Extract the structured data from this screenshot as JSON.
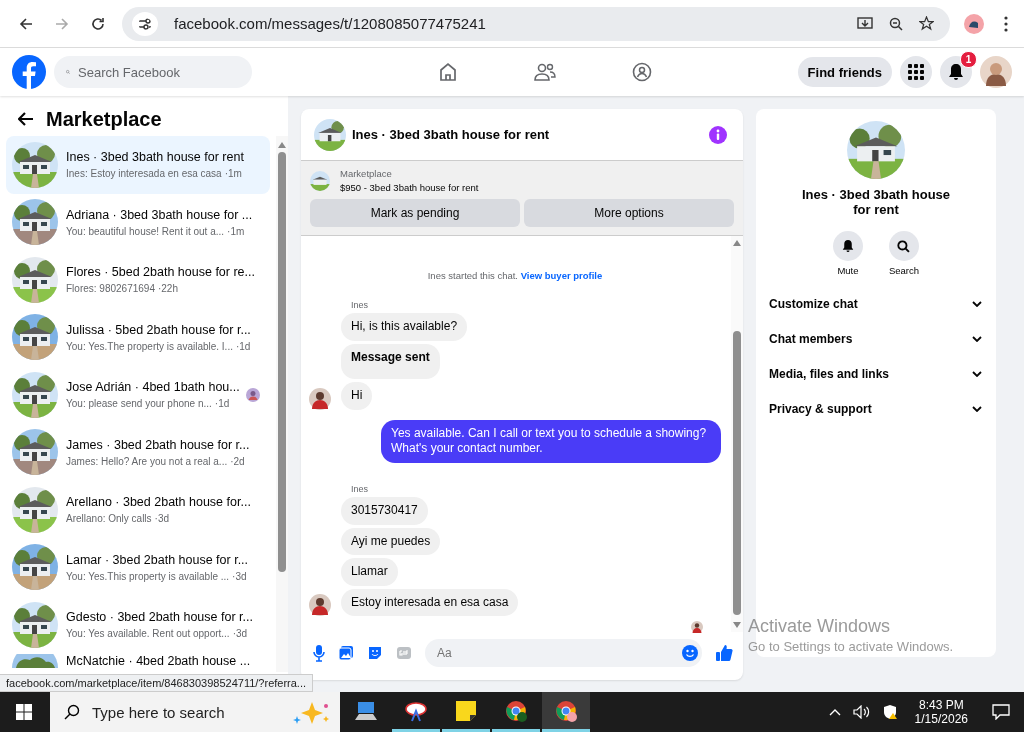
{
  "browser": {
    "url": "facebook.com/messages/t/1208085077475241"
  },
  "header": {
    "search": {
      "placeholder": "Search Facebook"
    },
    "find_friends": "Find friends",
    "notification_count": "1"
  },
  "sidebar": {
    "title": "Marketplace",
    "conversations": [
      {
        "title": "Ines · 3bed 3bath house for rent",
        "preview": "Ines: Estoy interesada en esa casa",
        "time": "·1m",
        "selected": true,
        "seen": false
      },
      {
        "title": "Adriana · 3bed 3bath house for ...",
        "preview": "You: beautiful house! Rent it out a...",
        "time": "·1m",
        "selected": false,
        "seen": false
      },
      {
        "title": "Flores · 5bed 2bath house for re...",
        "preview": "Flores: 9802671694",
        "time": "·22h",
        "selected": false,
        "seen": false
      },
      {
        "title": "Julissa · 5bed 2bath house for r...",
        "preview": "You: Yes.The property is available. I...",
        "time": "·1d",
        "selected": false,
        "seen": false
      },
      {
        "title": "Jose Adrián · 4bed 1bath hou...",
        "preview": "You: please send your phone n...",
        "time": "·1d",
        "selected": false,
        "seen": true
      },
      {
        "title": "James · 3bed 2bath house for r...",
        "preview": "James: Hello? Are you not a real a...",
        "time": "·2d",
        "selected": false,
        "seen": false
      },
      {
        "title": "Arellano · 3bed 2bath house for...",
        "preview": "Arellano: Only calls",
        "time": "·3d",
        "selected": false,
        "seen": false
      },
      {
        "title": "Lamar · 3bed 2bath house for r...",
        "preview": "You: Yes.This property is available ...",
        "time": "·3d",
        "selected": false,
        "seen": false
      },
      {
        "title": "Gdesto · 3bed 2bath house for r...",
        "preview": "You: Yes available. Rent out opport...",
        "time": "·3d",
        "selected": false,
        "seen": false
      },
      {
        "title": "McNatchie · 4bed 2bath house ...",
        "selected": false,
        "seen": false
      }
    ]
  },
  "chat": {
    "title": "Ines · 3bed 3bath house for rent",
    "listing": {
      "label": "Marketplace",
      "price_title": "$950 - 3bed 3bath house for rent",
      "buttons": [
        "Mark as pending",
        "More options"
      ]
    },
    "messages": [
      {
        "kind": "system",
        "text": "Ines started this chat.",
        "link": "View buyer profile"
      },
      {
        "kind": "sender",
        "text": "Ines"
      },
      {
        "kind": "incoming",
        "text": "Hi, is this available?",
        "avatar": false
      },
      {
        "kind": "notice",
        "text": "Message sent",
        "avatar": false
      },
      {
        "kind": "incoming",
        "text": "Hi",
        "avatar": true
      },
      {
        "kind": "outgoing",
        "text": "Yes available. Can I call or text you to schedule a showing? What's your contact number."
      },
      {
        "kind": "sender",
        "text": "Ines"
      },
      {
        "kind": "incoming",
        "text": "3015730417",
        "avatar": false
      },
      {
        "kind": "incoming",
        "text": "Ayi me puedes",
        "avatar": false
      },
      {
        "kind": "incoming",
        "text": "Llamar",
        "avatar": false
      },
      {
        "kind": "incoming",
        "text": "Estoy interesada en esa casa",
        "avatar": true
      },
      {
        "kind": "read"
      }
    ],
    "composer": {
      "placeholder": "Aa"
    }
  },
  "details": {
    "title": "Ines · 3bed 3bath house for rent",
    "actions": [
      "Mute",
      "Search"
    ],
    "sections": [
      {
        "label": "Customize chat",
        "expanded": false
      },
      {
        "label": "Chat members",
        "expanded": false
      },
      {
        "label": "Media, files and links",
        "expanded": false
      },
      {
        "label": "Privacy & support",
        "expanded": false
      }
    ]
  },
  "status_url": "facebook.com/marketplace/item/846830398524711/?referra...",
  "activation": {
    "title": "Activate Windows",
    "subtitle": "Go to Settings to activate Windows."
  },
  "taskbar": {
    "search": {
      "placeholder": "Type here to search"
    },
    "time": "8:43 PM",
    "date": "1/15/2026"
  }
}
